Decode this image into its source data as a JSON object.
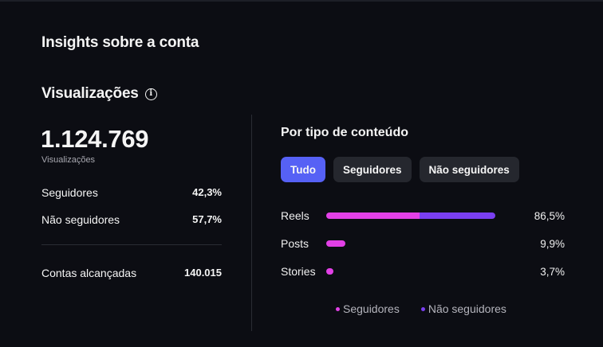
{
  "page_title": "Insights sobre a conta",
  "section_title": "Visualizações",
  "info_icon": "info-icon",
  "summary": {
    "total": "1.124.769",
    "total_label": "Visualizações",
    "rows": [
      {
        "label": "Seguidores",
        "value": "42,3%"
      },
      {
        "label": "Não seguidores",
        "value": "57,7%"
      }
    ],
    "reach": {
      "label": "Contas alcançadas",
      "value": "140.015"
    }
  },
  "content_type": {
    "title": "Por tipo de conteúdo",
    "tabs": [
      "Tudo",
      "Seguidores",
      "Não seguidores"
    ],
    "active_tab": "Tudo",
    "bars": [
      {
        "label": "Reels",
        "value": "86,5%",
        "total_pct": 86.5,
        "followers_share": 0.55
      },
      {
        "label": "Posts",
        "value": "9,9%",
        "total_pct": 9.9,
        "followers_share": 1.0
      },
      {
        "label": "Stories",
        "value": "3,7%",
        "total_pct": 3.7,
        "followers_share": 1.0
      }
    ],
    "legend": [
      {
        "label": "Seguidores",
        "color": "#e240e6"
      },
      {
        "label": "Não seguidores",
        "color": "#7a3ff0"
      }
    ]
  }
}
